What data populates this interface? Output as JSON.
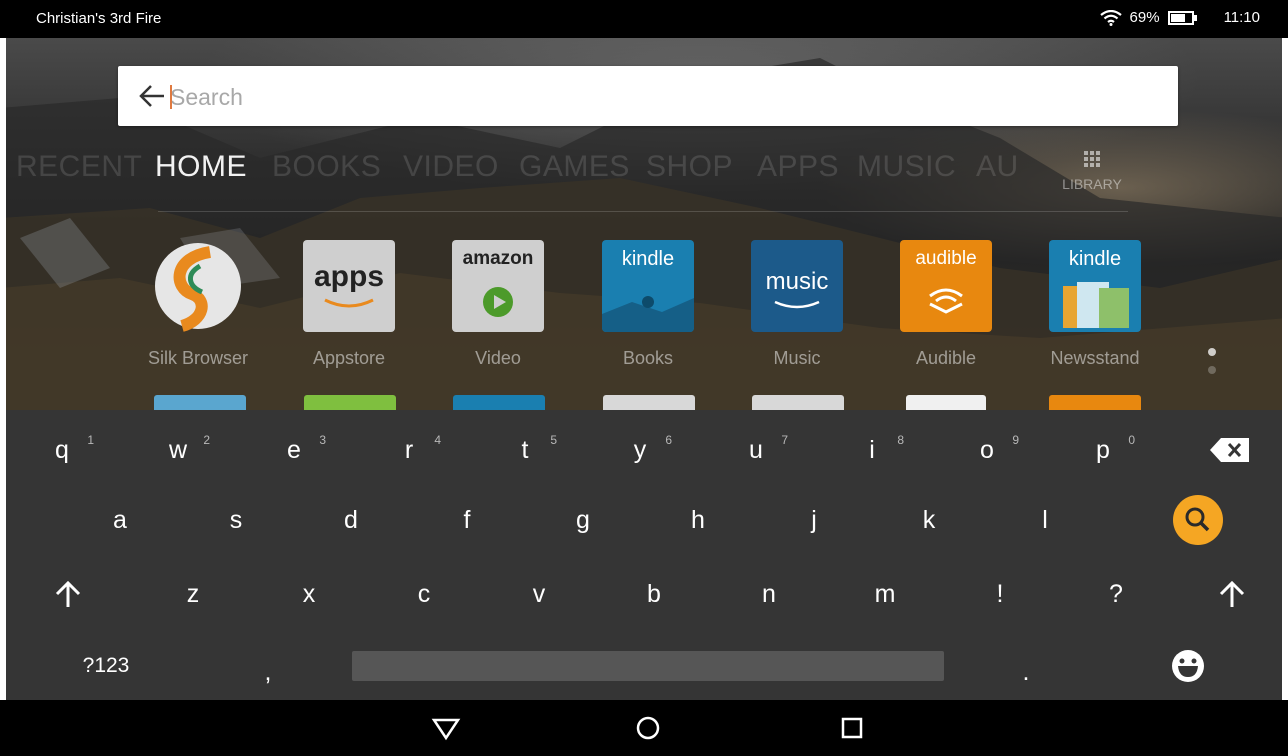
{
  "status_bar": {
    "device_name": "Christian's 3rd Fire",
    "battery_percent": "69%",
    "time": "11:10"
  },
  "search": {
    "placeholder": "Search"
  },
  "nav_tabs": [
    {
      "label": "RECENT",
      "active": false
    },
    {
      "label": "HOME",
      "active": true
    },
    {
      "label": "BOOKS",
      "active": false
    },
    {
      "label": "VIDEO",
      "active": false
    },
    {
      "label": "GAMES",
      "active": false
    },
    {
      "label": "SHOP",
      "active": false
    },
    {
      "label": "APPS",
      "active": false
    },
    {
      "label": "MUSIC",
      "active": false
    },
    {
      "label": "AU",
      "active": false
    }
  ],
  "library": {
    "label": "LIBRARY"
  },
  "apps": [
    {
      "label": "Silk Browser",
      "tile_text": "",
      "color": "#cfcfcf"
    },
    {
      "label": "Appstore",
      "tile_text": "apps",
      "color": "#cfcfcf"
    },
    {
      "label": "Video",
      "tile_text": "amazon",
      "color": "#cfcfcf"
    },
    {
      "label": "Books",
      "tile_text": "kindle",
      "color": "#1a7fb0"
    },
    {
      "label": "Music",
      "tile_text": "music",
      "color": "#1c5a8a"
    },
    {
      "label": "Audible",
      "tile_text": "audible",
      "color": "#e8880f"
    },
    {
      "label": "Newsstand",
      "tile_text": "kindle",
      "color": "#1a7fb0"
    }
  ],
  "keyboard": {
    "row1": [
      {
        "key": "q",
        "hint": "1"
      },
      {
        "key": "w",
        "hint": "2"
      },
      {
        "key": "e",
        "hint": "3"
      },
      {
        "key": "r",
        "hint": "4"
      },
      {
        "key": "t",
        "hint": "5"
      },
      {
        "key": "y",
        "hint": "6"
      },
      {
        "key": "u",
        "hint": "7"
      },
      {
        "key": "i",
        "hint": "8"
      },
      {
        "key": "o",
        "hint": "9"
      },
      {
        "key": "p",
        "hint": "0"
      }
    ],
    "row2": [
      "a",
      "s",
      "d",
      "f",
      "g",
      "h",
      "j",
      "k",
      "l"
    ],
    "row3": [
      "z",
      "x",
      "c",
      "v",
      "b",
      "n",
      "m",
      "!",
      "?"
    ],
    "symbols_label": "?123",
    "comma": ",",
    "period": ".",
    "accent_color": "#f5a623"
  }
}
